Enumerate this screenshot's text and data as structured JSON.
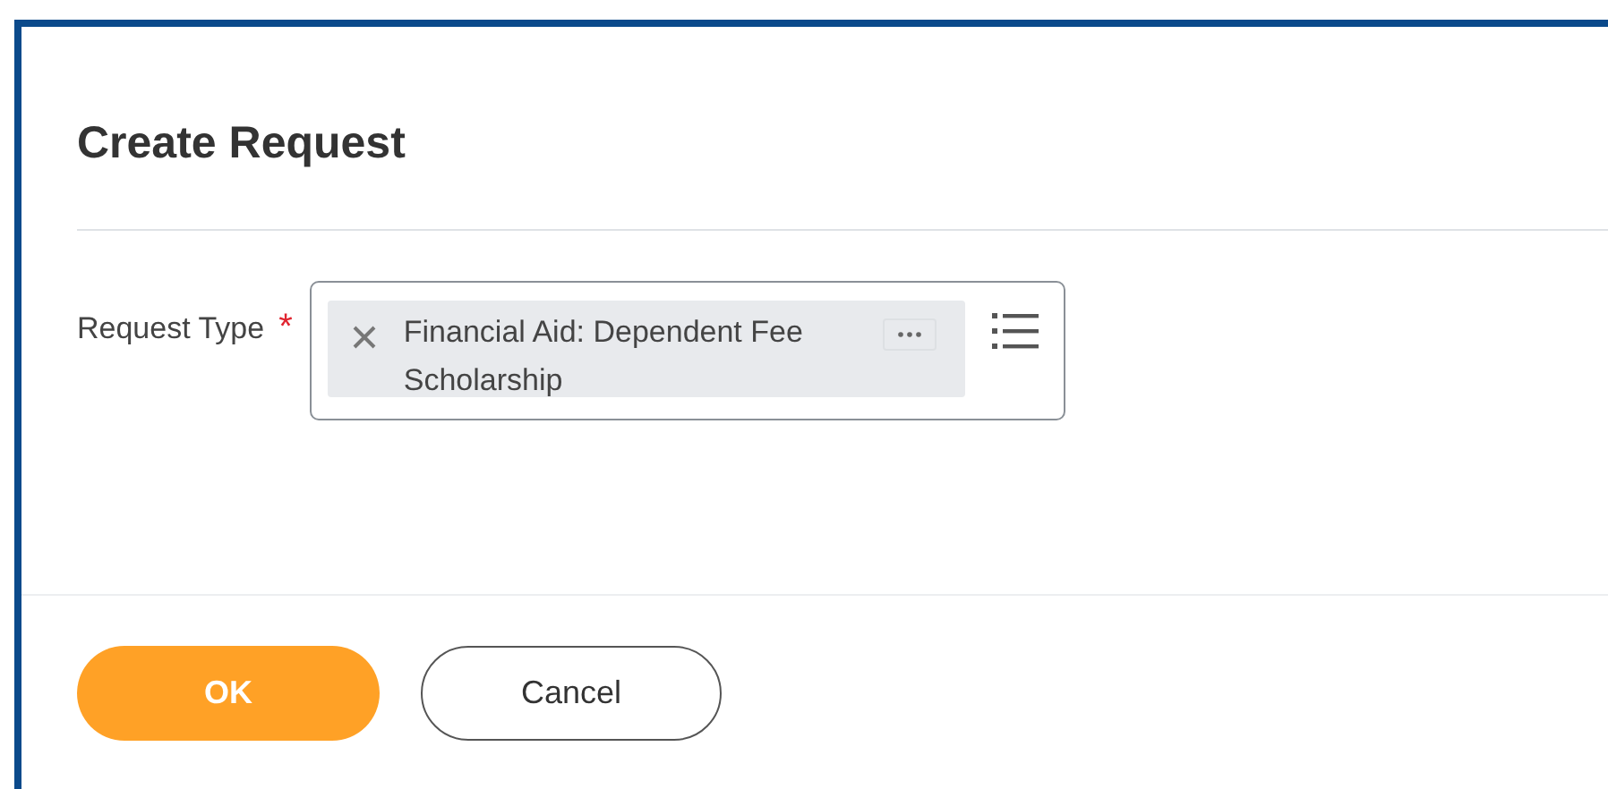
{
  "dialog": {
    "title": "Create Request"
  },
  "field": {
    "label": "Request Type",
    "required_mark": "*",
    "selected_item": "Financial Aid: Dependent Fee Scholarship"
  },
  "buttons": [
    {
      "label": "OK",
      "kind": "primary"
    },
    {
      "label": "Cancel",
      "kind": "secondary"
    }
  ]
}
